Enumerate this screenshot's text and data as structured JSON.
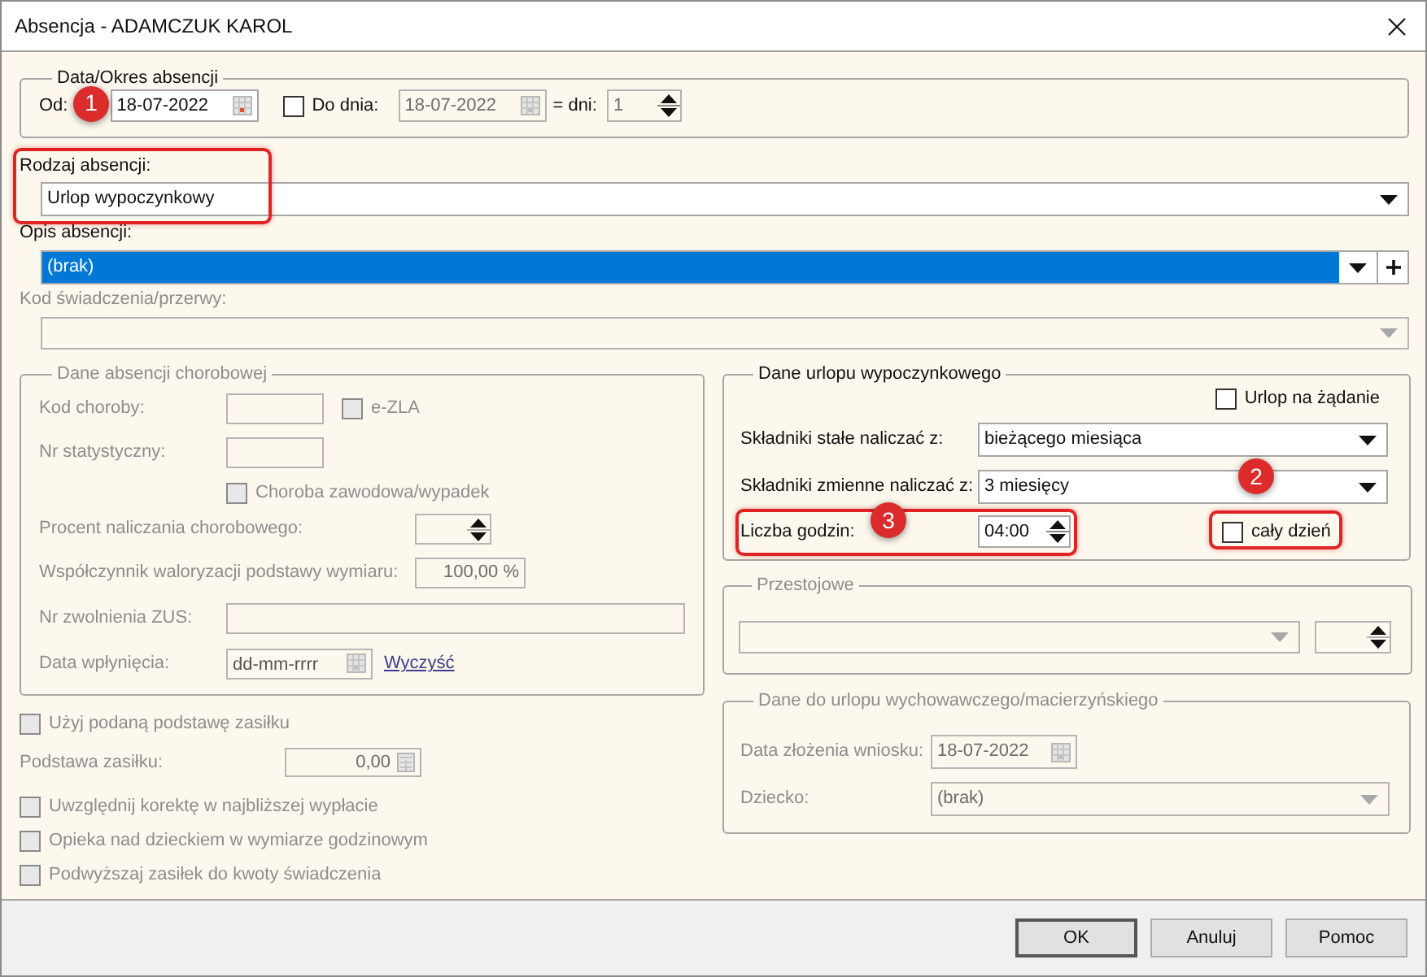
{
  "window": {
    "title": "Absencja - ADAMCZUK KAROL"
  },
  "period": {
    "legend": "Data/Okres absencji",
    "from_label": "Od:",
    "from_date": "18-07-2022",
    "callout": "1",
    "to": {
      "label": "Do dnia:",
      "checked": false
    },
    "to_date": "18-07-2022",
    "days_label": "= dni:",
    "days": "1"
  },
  "absence_type": {
    "label": "Rodzaj absencji:",
    "value": "Urlop wypoczynkowy",
    "highlighted": true
  },
  "description": {
    "label": "Opis absencji:",
    "value": "(brak)",
    "selected": true
  },
  "benefit_code": {
    "label": "Kod świadczenia/przerwy:",
    "disabled": true
  },
  "sick_leave": {
    "legend": "Dane absencji chorobowej",
    "disabled": true,
    "disease_code_label": "Kod choroby:",
    "ezla": {
      "label": "e-ZLA",
      "checked": false
    },
    "stat_no_label": "Nr statystyczny:",
    "occupational": {
      "label": "Choroba zawodowa/wypadek",
      "checked": false
    },
    "percent_label": "Procent naliczania chorobowego:",
    "valorization_label": "Współczynnik waloryzacji podstawy wymiaru:",
    "valorization": "100,00 %",
    "zus_label": "Nr zwolnienia ZUS:",
    "received_label": "Data wpłynięcia:",
    "received_placeholder": "dd-mm-rrrr",
    "clear_link": "Wyczyść"
  },
  "use_base": {
    "label": "Użyj podaną podstawę zasiłku",
    "checked": false,
    "disabled": true
  },
  "base": {
    "label": "Podstawa zasiłku:",
    "value": "0,00",
    "disabled": true
  },
  "options": [
    {
      "label": "Uwzględnij korektę w najbliższej wypłacie",
      "checked": false,
      "disabled": true
    },
    {
      "label": "Opieka nad dzieckiem w wymiarze godzinowym",
      "checked": false,
      "disabled": true
    },
    {
      "label": "Podwyższaj zasiłek do kwoty świadczenia",
      "checked": false,
      "disabled": true
    }
  ],
  "vacation": {
    "legend": "Dane urlopu wypoczynkowego",
    "on_demand": {
      "label": "Urlop na żądanie",
      "checked": false
    },
    "fixed_label": "Składniki stałe naliczać z:",
    "fixed_value": "bieżącego miesiąca",
    "variable_label": "Składniki zmienne naliczać z:",
    "variable_value": "3 miesięcy",
    "hours_label": "Liczba godzin:",
    "hours": "04:00",
    "hours_callout": "3",
    "hours_highlighted": true,
    "full_day": {
      "label": "cały dzień",
      "checked": false,
      "callout": "2",
      "highlighted": true
    }
  },
  "downtime": {
    "legend": "Przestojowe",
    "disabled": true
  },
  "parental": {
    "legend": "Dane do urlopu wychowawczego/macierzyńskiego",
    "disabled": true,
    "request_date_label": "Data złożenia wniosku:",
    "request_date": "18-07-2022",
    "child_label": "Dziecko:",
    "child": "(brak)"
  },
  "buttons": [
    {
      "label": "OK",
      "default": true
    },
    {
      "label": "Anuluj",
      "default": false
    },
    {
      "label": "Pomoc",
      "default": false
    }
  ]
}
